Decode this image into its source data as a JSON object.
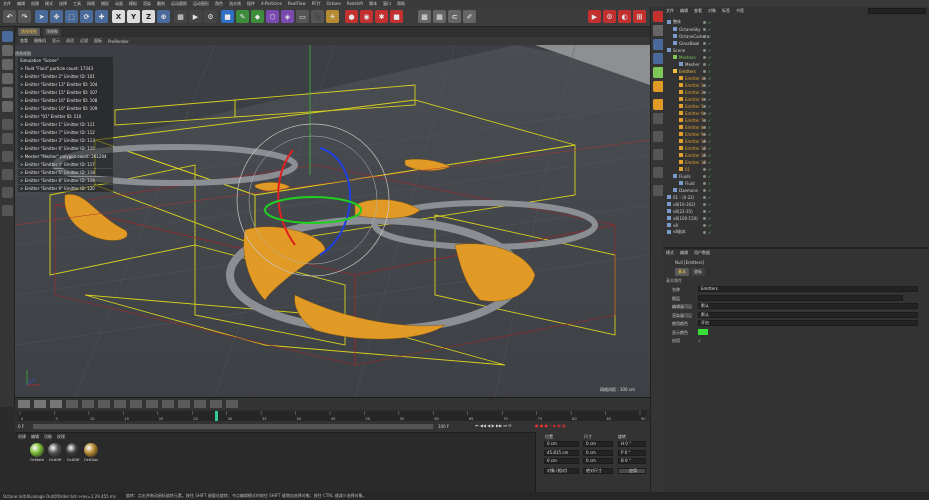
{
  "menubar": [
    "文件",
    "编辑",
    "创建",
    "模式",
    "选择",
    "工具",
    "网格",
    "捕捉",
    "动画",
    "模拟",
    "渲染",
    "雕刻",
    "运动跟踪",
    "运动图形",
    "角色",
    "流水线",
    "插件",
    "X-Particles",
    "RealFlow",
    "RF|Y",
    "Octane",
    "Redshift",
    "脚本",
    "窗口",
    "帮助"
  ],
  "toolbar": {
    "axes": [
      "X",
      "Y",
      "Z"
    ]
  },
  "viewport": {
    "tabs": [
      {
        "label": "透视视图"
      },
      {
        "label": "顶视图"
      }
    ],
    "menu": [
      "查看",
      "摄像机",
      "显示",
      "选项",
      "过滤",
      "面板",
      "ProRender"
    ],
    "corner_label": "透视视图",
    "hud": [
      "Simulation \"Scene\"",
      "> Fluid \"Fluid\" particle count: 17343",
      "> Emitter \"Emitter 2\" Emitter ID: 101",
      "> Emitter \"Emitter 13\" Emitter ID: 104",
      "> Emitter \"Emitter 15\" Emitter ID: 107",
      "> Emitter \"Emitter 16\" Emitter ID: 108",
      "> Emitter \"Emitter 10\" Emitter ID: 109",
      "> Emitter \"01\" Emitter ID: 110",
      "> Emitter \"Emitter 1\" Emitter ID: 111",
      "> Emitter \"Emitter 7\" Emitter ID: 112",
      "> Emitter \"Emitter 3\" Emitter ID: 113",
      "> Emitter \"Emitter 6\" Emitter ID: 115",
      "> Mesher \"Mesher\" polygon count: 261204",
      "> Emitter \"Emitter 4\" Emitter ID: 117",
      "> Emitter \"Emitter 5\" Emitter ID: 118",
      "> Emitter \"Emitter 8\" Emitter ID: 119",
      "> Emitter \"Emitter 9\" Emitter ID: 120"
    ],
    "scale_label": "网格间距 : 100 cm"
  },
  "timeline": {
    "ticks": [
      "0",
      "5",
      "10",
      "15",
      "20",
      "25",
      "30",
      "35",
      "40",
      "45",
      "50",
      "55",
      "60",
      "65",
      "70",
      "75",
      "80",
      "85",
      "90"
    ],
    "current_frame": "0 F",
    "end_frame": "100 F"
  },
  "materials": {
    "tabs": [
      "创建",
      "编辑",
      "功能",
      "纹理"
    ],
    "items": [
      {
        "name": "OcMate",
        "color": "#7dbe3a"
      },
      {
        "name": "OctDiff",
        "color": "#555555"
      },
      {
        "name": "OctDiff",
        "color": "#3e3e3e"
      },
      {
        "name": "OctGlos",
        "color": "#b58a32"
      }
    ]
  },
  "coords": {
    "headers": [
      "位置",
      "尺寸",
      "旋转"
    ],
    "rows": [
      {
        "pos": "0 cm",
        "size": "0 cm",
        "rot": "H 0 °"
      },
      {
        "pos": "45.815 cm",
        "size": "0 cm",
        "rot": "P 0 °"
      },
      {
        "pos": "0 cm",
        "size": "0 cm",
        "rot": "B 0 °"
      }
    ],
    "mode": "对象 (相对)",
    "size_mode": "绝对尺寸",
    "apply": "应用"
  },
  "objects": {
    "tabs": [
      "文件",
      "编辑",
      "查看",
      "对象",
      "标签",
      "书签"
    ],
    "search": "",
    "items": [
      {
        "name": "整体",
        "indent": 0,
        "color": "#cfcfcf"
      },
      {
        "name": "OctaneSky",
        "indent": 1,
        "color": "#cfcfcf"
      },
      {
        "name": "OctaneCamera",
        "indent": 1,
        "color": "#cfcfcf"
      },
      {
        "name": "GlassBowl",
        "indent": 1,
        "color": "#cfcfcf"
      },
      {
        "name": "Scene",
        "indent": 0,
        "color": "#cfcfcf"
      },
      {
        "name": "Meshers",
        "indent": 1,
        "color": "#7ec85a"
      },
      {
        "name": "Mesher",
        "indent": 2,
        "color": "#cfcfcf"
      },
      {
        "name": "Emitters",
        "indent": 1,
        "color": "#f0c040"
      },
      {
        "name": "Emitter 1",
        "indent": 2,
        "color": "#e0a030"
      },
      {
        "name": "Emitter 2",
        "indent": 2,
        "color": "#e0a030"
      },
      {
        "name": "Emitter 3",
        "indent": 2,
        "color": "#e0a030"
      },
      {
        "name": "Emitter 4",
        "indent": 2,
        "color": "#e0a030"
      },
      {
        "name": "Emitter 5",
        "indent": 2,
        "color": "#e0a030"
      },
      {
        "name": "Emitter 6",
        "indent": 2,
        "color": "#e0a030"
      },
      {
        "name": "Emitter 7",
        "indent": 2,
        "color": "#e0a030"
      },
      {
        "name": "Emitter 8",
        "indent": 2,
        "color": "#e0a030"
      },
      {
        "name": "Emitter 9",
        "indent": 2,
        "color": "#e0a030"
      },
      {
        "name": "Emitter 10",
        "indent": 2,
        "color": "#e0a030"
      },
      {
        "name": "Emitter 13",
        "indent": 2,
        "color": "#e0a030"
      },
      {
        "name": "Emitter 15",
        "indent": 2,
        "color": "#e0a030"
      },
      {
        "name": "Emitter 16",
        "indent": 2,
        "color": "#e0a030"
      },
      {
        "name": "01",
        "indent": 2,
        "color": "#e0a030"
      },
      {
        "name": "Fluids",
        "indent": 1,
        "color": "#cfcfcf"
      },
      {
        "name": "Fluid",
        "indent": 2,
        "color": "#cfcfcf"
      },
      {
        "name": "Daemons",
        "indent": 1,
        "color": "#cfcfcf"
      },
      {
        "name": "01 - (0-22)",
        "indent": 0,
        "color": "#cfcfcf"
      },
      {
        "name": "v8(10-162)",
        "indent": 0,
        "color": "#cfcfcf"
      },
      {
        "name": "v8(22-35)",
        "indent": 0,
        "color": "#cfcfcf"
      },
      {
        "name": "v8(100-150)",
        "indent": 0,
        "color": "#cfcfcf"
      },
      {
        "name": "v8",
        "indent": 0,
        "color": "#cfcfcf"
      },
      {
        "name": "v8副本",
        "indent": 0,
        "color": "#cfcfcf"
      }
    ]
  },
  "attributes": {
    "tabs": [
      "模式",
      "编辑",
      "用户数据"
    ],
    "title": "Null [Emitters]",
    "subtabs": [
      "基本",
      "坐标"
    ],
    "section": "基本属性",
    "fields": [
      {
        "label": "名称",
        "value": "Emitters"
      },
      {
        "label": "图层",
        "value": ""
      },
      {
        "label": "编辑器可见",
        "value": "默认"
      },
      {
        "label": "渲染器可见",
        "value": "默认"
      },
      {
        "label": "使用颜色",
        "value": "开启"
      },
      {
        "label": "显示颜色",
        "value": ""
      },
      {
        "label": "启用",
        "value": "✓"
      }
    ],
    "display_color": "#3adf3a"
  },
  "status": {
    "left": "Octane:initUILinkage OutOfOrder:list->rev=1  29.455 ms",
    "right": "旋转：点击并拖动鼠标旋转元素。按住 SHIFT 键量化旋转；节点编辑模式时按住 SHIFT 键增加选择对象；按住 CTRL 键减少选择对象。"
  }
}
